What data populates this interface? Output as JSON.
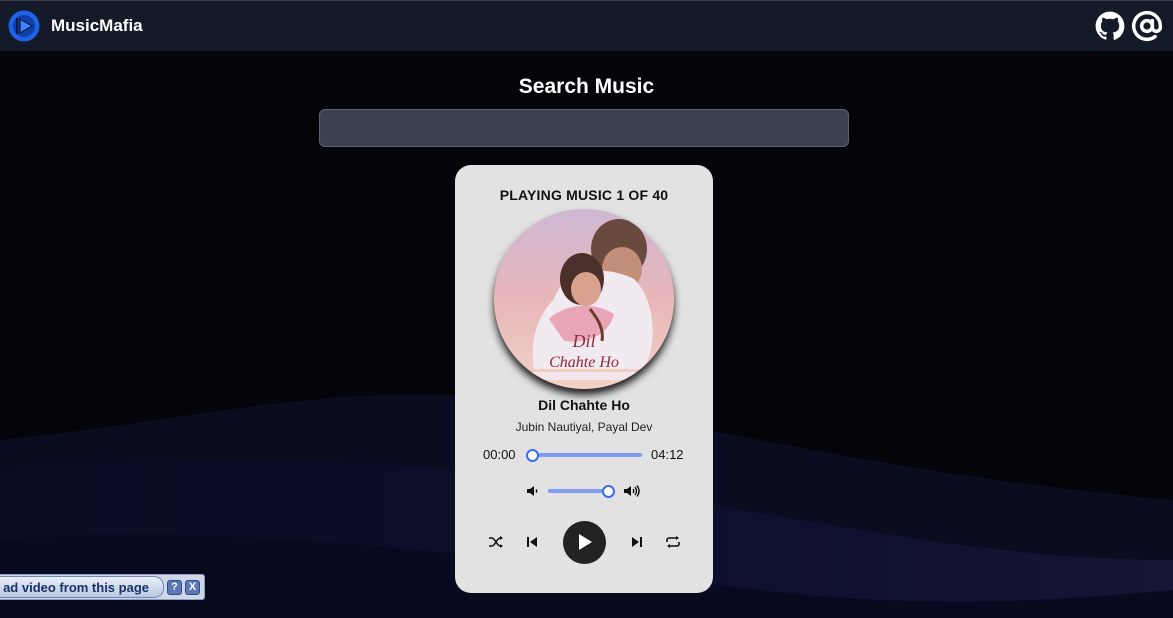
{
  "app": {
    "name": "MusicMafia",
    "accent": "#3b6cf0",
    "bar_color": "#151a28"
  },
  "header": {
    "icons": [
      "github-icon",
      "at-sign-icon"
    ]
  },
  "search": {
    "title": "Search Music",
    "value": "",
    "placeholder": ""
  },
  "player": {
    "status": "PLAYING MUSIC 1 OF 40",
    "cover_text": "DIL CHAHTE HO",
    "track_title": "Dil Chahte Ho",
    "artist": "Jubin Nautiyal, Payal Dev",
    "current_time": "00:00",
    "duration": "04:12",
    "progress_fraction": 0.0,
    "volume_fraction": 1.0,
    "controls": [
      "shuffle-icon",
      "previous-icon",
      "play-icon",
      "next-icon",
      "repeat-icon"
    ]
  },
  "download_bar": {
    "label": "ad video from this page",
    "help": "?",
    "close": "X"
  }
}
